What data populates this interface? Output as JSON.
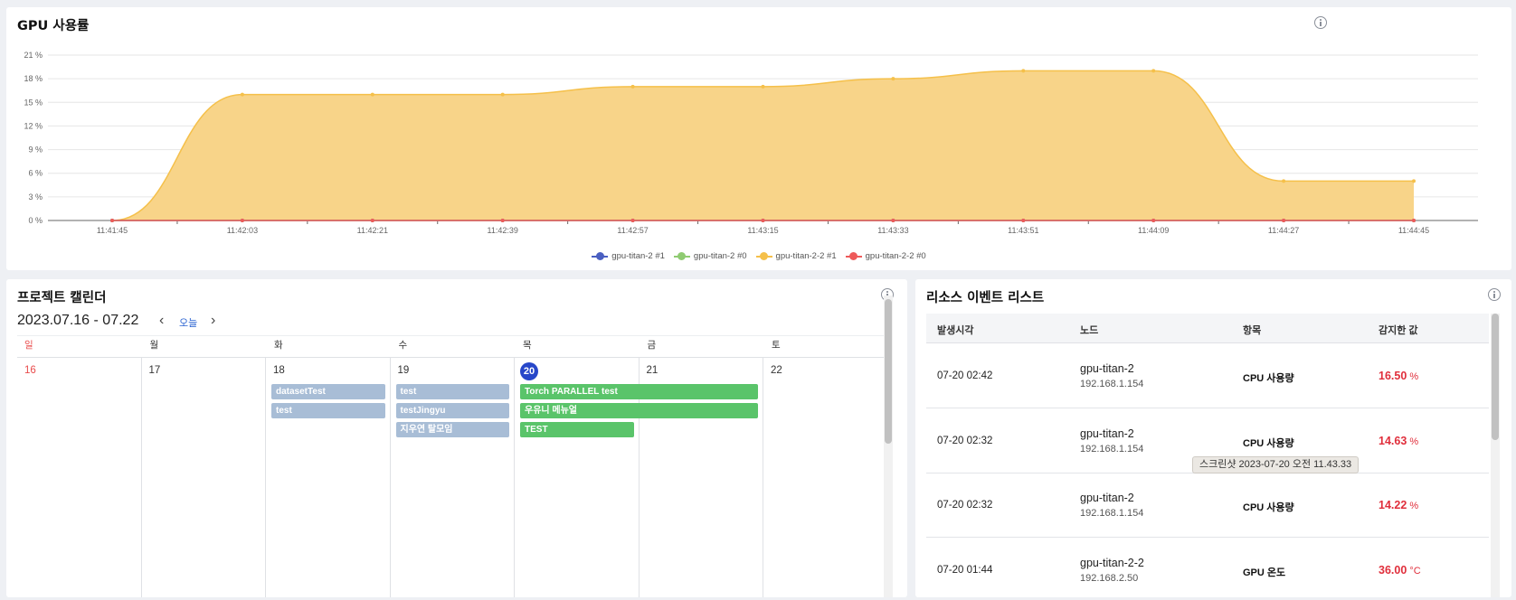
{
  "gpu_panel": {
    "title": "GPU 사용률"
  },
  "chart_data": {
    "type": "area",
    "title": "GPU 사용률",
    "x": [
      "11:41:45",
      "11:42:03",
      "11:42:21",
      "11:42:39",
      "11:42:57",
      "11:43:15",
      "11:43:33",
      "11:43:51",
      "11:44:09",
      "11:44:27",
      "11:44:45"
    ],
    "y_ticks": [
      "0 %",
      "3 %",
      "6 %",
      "9 %",
      "12 %",
      "15 %",
      "18 %",
      "21 %"
    ],
    "ylim": [
      0,
      21
    ],
    "grid": true,
    "legend_position": "bottom-center",
    "series": [
      {
        "name": "gpu-titan-2 #1",
        "color": "#4a5fc1",
        "values": [
          0,
          0,
          0,
          0,
          0,
          0,
          0,
          0,
          0,
          0,
          0
        ]
      },
      {
        "name": "gpu-titan-2 #0",
        "color": "#8fcb72",
        "values": [
          0,
          0,
          0,
          0,
          0,
          0,
          0,
          0,
          0,
          0,
          0
        ]
      },
      {
        "name": "gpu-titan-2-2 #1",
        "color": "#f5c04a",
        "values": [
          0,
          16,
          16,
          16,
          17,
          17,
          18,
          19,
          19,
          5,
          5
        ]
      },
      {
        "name": "gpu-titan-2-2 #0",
        "color": "#ee5a5a",
        "values": [
          0,
          0,
          0,
          0,
          0,
          0,
          0,
          0,
          0,
          0,
          0
        ]
      }
    ]
  },
  "calendar": {
    "title": "프로젝트 캘린더",
    "range": "2023.07.16 - 07.22",
    "today_label": "오늘",
    "prev_icon": "‹",
    "next_icon": "›",
    "weekdays": [
      "일",
      "월",
      "화",
      "수",
      "목",
      "금",
      "토"
    ],
    "dates": [
      "16",
      "17",
      "18",
      "19",
      "20",
      "21",
      "22"
    ],
    "today_index": 4,
    "events": [
      {
        "label": "datasetTest",
        "start_day": 2,
        "span": 1,
        "lane": 0,
        "color": "gray"
      },
      {
        "label": "test",
        "start_day": 2,
        "span": 1,
        "lane": 1,
        "color": "gray"
      },
      {
        "label": "test",
        "start_day": 3,
        "span": 1,
        "lane": 0,
        "color": "gray"
      },
      {
        "label": "testJingyu",
        "start_day": 3,
        "span": 1,
        "lane": 1,
        "color": "gray"
      },
      {
        "label": "지우연 탈모임",
        "start_day": 3,
        "span": 1,
        "lane": 2,
        "color": "gray"
      },
      {
        "label": "Torch PARALLEL test",
        "start_day": 4,
        "span": 2,
        "lane": 0,
        "color": "green"
      },
      {
        "label": "우유니 메뉴얼",
        "start_day": 4,
        "span": 2,
        "lane": 1,
        "color": "green"
      },
      {
        "label": "TEST",
        "start_day": 4,
        "span": 1,
        "lane": 2,
        "color": "green"
      }
    ]
  },
  "events_panel": {
    "title": "리소스 이벤트 리스트",
    "columns": {
      "time": "발생시각",
      "node": "노드",
      "item": "항목",
      "value": "감지한 값"
    },
    "rows": [
      {
        "time": "07-20 02:42",
        "node": "gpu-titan-2",
        "ip": "192.168.1.154",
        "item": "CPU 사용량",
        "value": "16.50",
        "unit": "%"
      },
      {
        "time": "07-20 02:32",
        "node": "gpu-titan-2",
        "ip": "192.168.1.154",
        "item": "CPU 사용량",
        "value": "14.63",
        "unit": "%"
      },
      {
        "time": "07-20 02:32",
        "node": "gpu-titan-2",
        "ip": "192.168.1.154",
        "item": "CPU 사용량",
        "value": "14.22",
        "unit": "%"
      },
      {
        "time": "07-20 01:44",
        "node": "gpu-titan-2-2",
        "ip": "192.168.2.50",
        "item": "GPU 온도",
        "value": "36.00",
        "unit": "°C"
      }
    ]
  },
  "tooltip": {
    "text": "스크린샷 2023-07-20 오전 11.43.33"
  },
  "colors": {
    "accent": "#2747c9",
    "alert": "#e02f3c",
    "area_fill": "#f8d489",
    "area_line": "#f5c04a"
  }
}
